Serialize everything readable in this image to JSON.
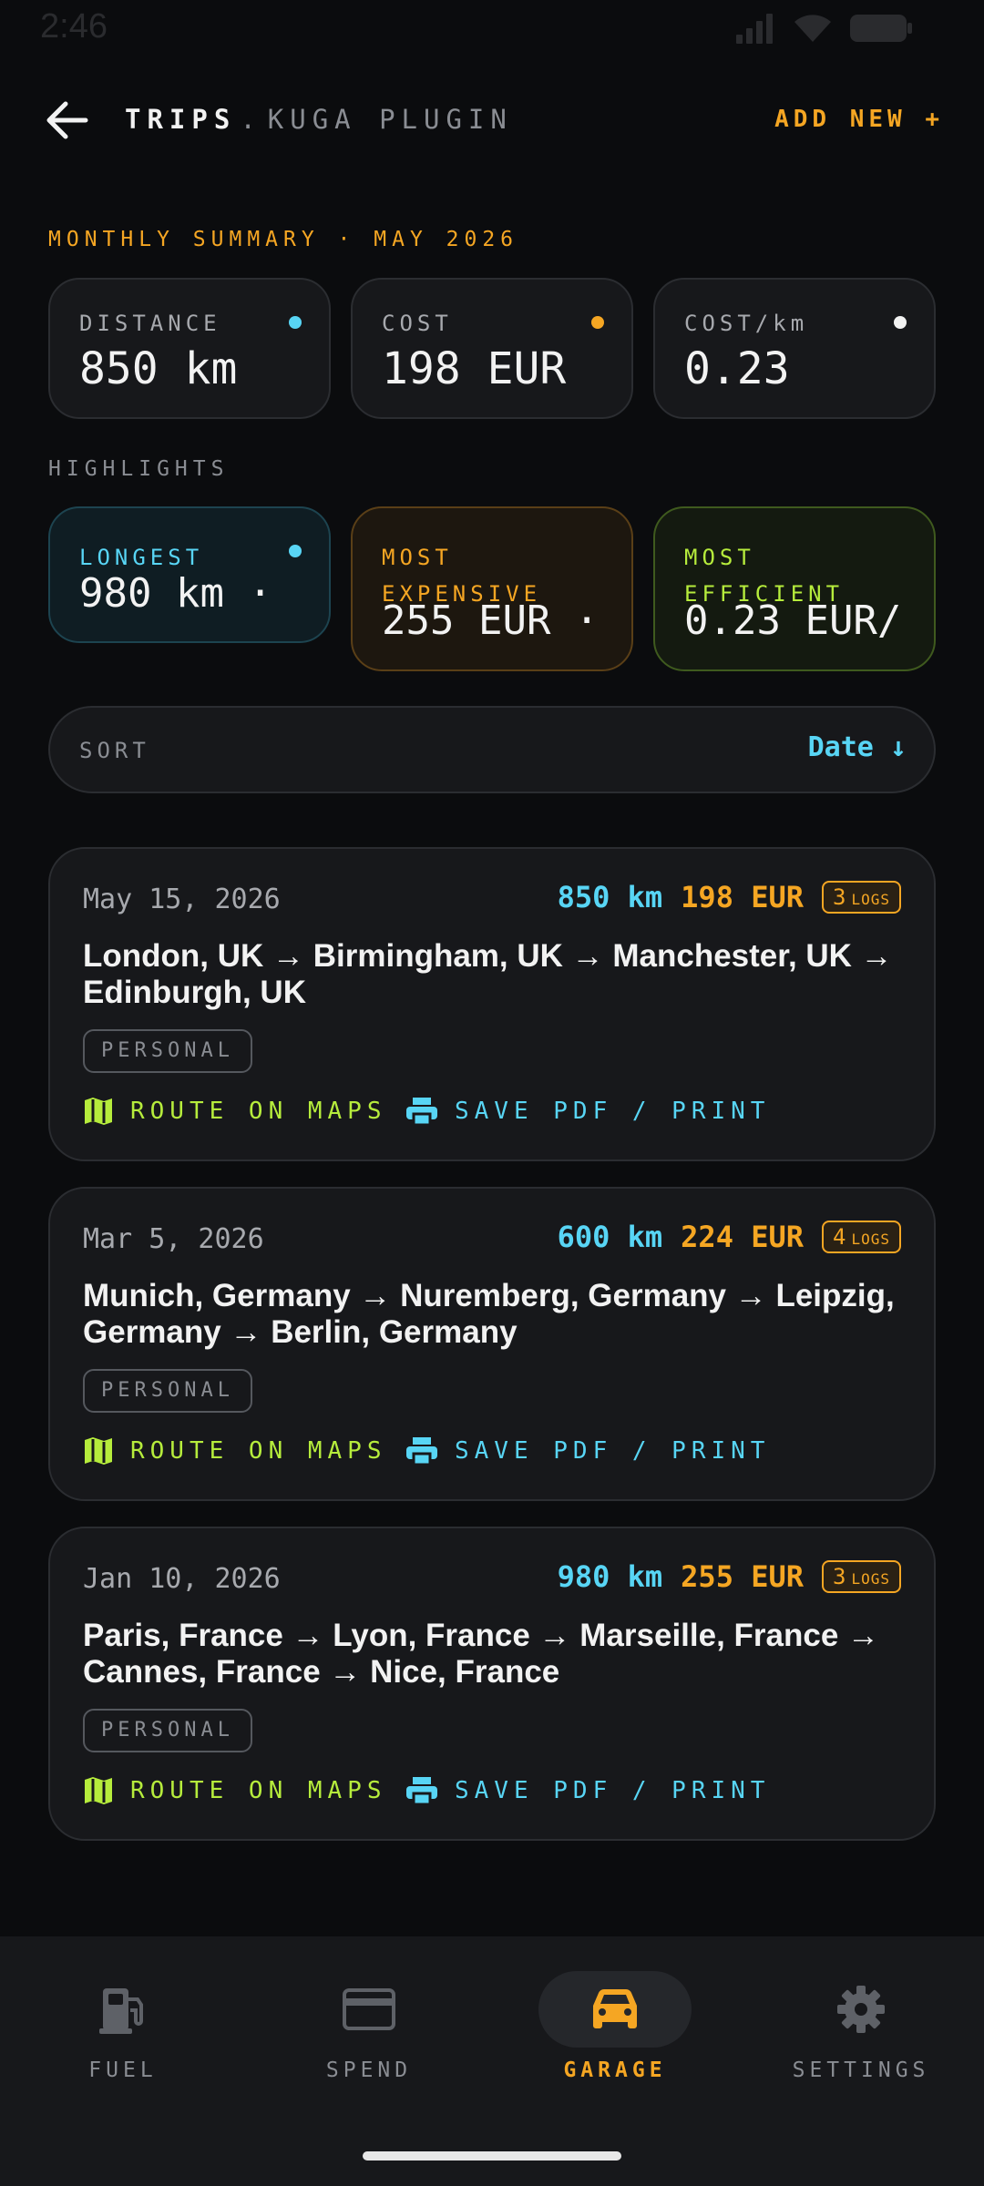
{
  "status": {
    "time": "2:46"
  },
  "header": {
    "title": "TRIPS",
    "separator": ".",
    "subtitle": "KUGA PLUGIN",
    "add_new": "ADD NEW +"
  },
  "summary": {
    "label": "MONTHLY SUMMARY · MAY 2026",
    "cards": [
      {
        "label": "DISTANCE",
        "value": "850 km",
        "dot_color": "#58d5f5"
      },
      {
        "label": "COST",
        "value": "198 EUR",
        "dot_color": "#f5a623"
      },
      {
        "label": "COST/km",
        "value": "0.23",
        "dot_color": "#f2f2f2"
      }
    ]
  },
  "highlights": {
    "label": "HIGHLIGHTS",
    "cards": [
      {
        "label": "LONGEST",
        "value": "980 km ·",
        "accent": "#58d5f5"
      },
      {
        "label": "MOST EXPENSIVE",
        "value": "255 EUR ·",
        "accent": "#f5a623"
      },
      {
        "label": "MOST EFFICIENT",
        "value": "0.23 EUR/",
        "accent": "#b6ec3c"
      }
    ]
  },
  "sort": {
    "label": "SORT",
    "value": "Date ↓"
  },
  "trips": [
    {
      "date": "May 15, 2026",
      "km": "850 km",
      "cost": "198 EUR",
      "logs_count": "3",
      "logs_label": "LOGS",
      "route": "London, UK → Birmingham, UK → Manchester, UK → Edinburgh, UK",
      "tag": "PERSONAL",
      "maps_label": "ROUTE ON MAPS",
      "pdf_label": "SAVE PDF / PRINT"
    },
    {
      "date": "Mar 5, 2026",
      "km": "600 km",
      "cost": "224 EUR",
      "logs_count": "4",
      "logs_label": "LOGS",
      "route": "Munich, Germany → Nuremberg, Germany → Leipzig, Germany → Berlin, Germany",
      "tag": "PERSONAL",
      "maps_label": "ROUTE ON MAPS",
      "pdf_label": "SAVE PDF / PRINT"
    },
    {
      "date": "Jan 10, 2026",
      "km": "980 km",
      "cost": "255 EUR",
      "logs_count": "3",
      "logs_label": "LOGS",
      "route": "Paris, France → Lyon, France → Marseille, France → Cannes, France → Nice, France",
      "tag": "PERSONAL",
      "maps_label": "ROUTE ON MAPS",
      "pdf_label": "SAVE PDF / PRINT"
    }
  ],
  "nav": [
    {
      "label": "FUEL",
      "icon": "fuel-icon",
      "active": false
    },
    {
      "label": "SPEND",
      "icon": "card-icon",
      "active": false
    },
    {
      "label": "GARAGE",
      "icon": "car-icon",
      "active": true
    },
    {
      "label": "SETTINGS",
      "icon": "gear-icon",
      "active": false
    }
  ],
  "colors": {
    "accent": "#f5a623",
    "cyan": "#58d5f5",
    "lime": "#b6ec3c",
    "background": "#0b0c0e",
    "card": "#17181b"
  }
}
